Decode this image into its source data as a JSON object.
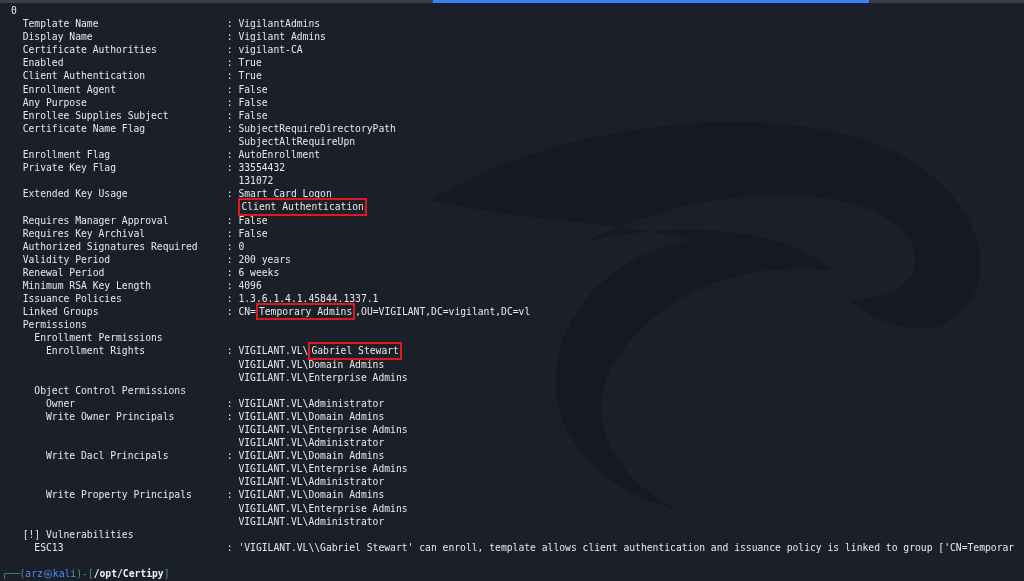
{
  "tab_bar": {
    "tabs": [
      {
        "selected": false
      },
      {
        "selected": true
      },
      {
        "selected": false
      }
    ]
  },
  "separator": ":",
  "index": "0",
  "fields": [
    {
      "key": "Template Name",
      "values": [
        "VigilantAdmins"
      ]
    },
    {
      "key": "Display Name",
      "values": [
        "Vigilant Admins"
      ]
    },
    {
      "key": "Certificate Authorities",
      "values": [
        "vigilant-CA"
      ]
    },
    {
      "key": "Enabled",
      "values": [
        "True"
      ]
    },
    {
      "key": "Client Authentication",
      "values": [
        "True"
      ]
    },
    {
      "key": "Enrollment Agent",
      "values": [
        "False"
      ]
    },
    {
      "key": "Any Purpose",
      "values": [
        "False"
      ]
    },
    {
      "key": "Enrollee Supplies Subject",
      "values": [
        "False"
      ]
    },
    {
      "key": "Certificate Name Flag",
      "values": [
        "SubjectRequireDirectoryPath",
        "SubjectAltRequireUpn"
      ]
    },
    {
      "key": "Enrollment Flag",
      "values": [
        "AutoEnrollment"
      ]
    },
    {
      "key": "Private Key Flag",
      "values": [
        "33554432",
        "131072"
      ]
    },
    {
      "key": "Extended Key Usage",
      "values": [
        "Smart Card Logon",
        [
          {
            "text": "Client Authentication",
            "boxed": true
          }
        ]
      ]
    },
    {
      "key": "Requires Manager Approval",
      "values": [
        "False"
      ]
    },
    {
      "key": "Requires Key Archival",
      "values": [
        "False"
      ]
    },
    {
      "key": "Authorized Signatures Required",
      "values": [
        "0"
      ]
    },
    {
      "key": "Validity Period",
      "values": [
        "200 years"
      ]
    },
    {
      "key": "Renewal Period",
      "values": [
        "6 weeks"
      ]
    },
    {
      "key": "Minimum RSA Key Length",
      "values": [
        "4096"
      ]
    },
    {
      "key": "Issuance Policies",
      "values": [
        "1.3.6.1.4.1.45844.1337.1"
      ]
    },
    {
      "key": "Linked Groups",
      "values": [
        [
          {
            "text": "CN=",
            "boxed": false
          },
          {
            "text": "Temporary Admins",
            "boxed": true
          },
          {
            "text": ",OU=VIGILANT,DC=vigilant,DC=vl",
            "boxed": false
          }
        ]
      ]
    },
    {
      "key": "Permissions",
      "children": [
        {
          "key": "Enrollment Permissions",
          "children": [
            {
              "key": "Enrollment Rights",
              "values": [
                [
                  {
                    "text": "VIGILANT.VL\\",
                    "boxed": false
                  },
                  {
                    "text": "Gabriel Stewart",
                    "boxed": true
                  }
                ],
                "VIGILANT.VL\\Domain Admins",
                "VIGILANT.VL\\Enterprise Admins"
              ]
            }
          ]
        },
        {
          "key": "Object Control Permissions",
          "children": [
            {
              "key": "Owner",
              "values": [
                "VIGILANT.VL\\Administrator"
              ]
            },
            {
              "key": "Write Owner Principals",
              "values": [
                "VIGILANT.VL\\Domain Admins",
                "VIGILANT.VL\\Enterprise Admins",
                "VIGILANT.VL\\Administrator"
              ]
            },
            {
              "key": "Write Dacl Principals",
              "values": [
                "VIGILANT.VL\\Domain Admins",
                "VIGILANT.VL\\Enterprise Admins",
                "VIGILANT.VL\\Administrator"
              ]
            },
            {
              "key": "Write Property Principals",
              "values": [
                "VIGILANT.VL\\Domain Admins",
                "VIGILANT.VL\\Enterprise Admins",
                "VIGILANT.VL\\Administrator"
              ]
            }
          ]
        }
      ]
    },
    {
      "key": "[!] Vulnerabilities",
      "children": [
        {
          "key": "ESC13",
          "values": [
            "'VIGILANT.VL\\\\Gabriel Stewart' can enroll, template allows client authentication and issuance policy is linked to group ['CN=Temporar"
          ]
        }
      ]
    }
  ],
  "prompt": [
    {
      "text": "┌──(",
      "kind": "frame"
    },
    {
      "text": "arz㉿kali",
      "kind": "user"
    },
    {
      "text": ")-[",
      "kind": "frame"
    },
    {
      "text": "/opt/Certipy",
      "kind": "path"
    },
    {
      "text": "]",
      "kind": "frame"
    }
  ]
}
